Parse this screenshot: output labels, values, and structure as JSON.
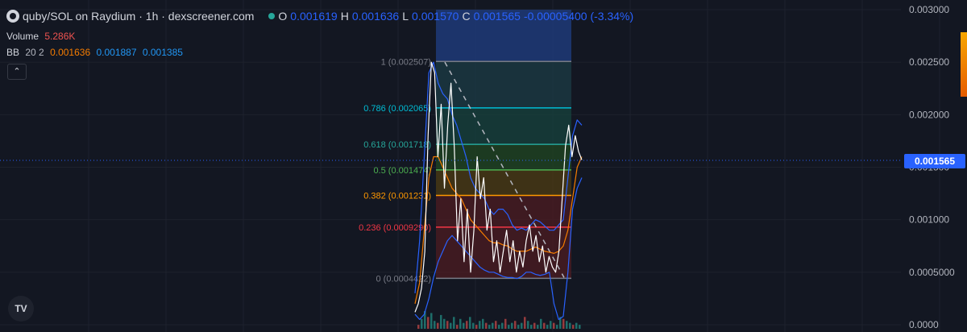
{
  "header": {
    "title": "quby/SOL on Raydium · 1h · dexscreener.com",
    "ohlc": [
      {
        "key": "O",
        "value": "0.001619"
      },
      {
        "key": "H",
        "value": "0.001636"
      },
      {
        "key": "L",
        "value": "0.001570"
      },
      {
        "key": "C",
        "value": "0.001565"
      }
    ],
    "change": "-0.00005400 (-3.34%)"
  },
  "volume": {
    "label": "Volume",
    "value": "5.286K"
  },
  "bb": {
    "label": "BB",
    "params": "20 2",
    "upper": "0.001636",
    "middle": "0.001887",
    "lower": "0.001385",
    "colors": {
      "orange": "#f57c00",
      "blue": "#2196f3"
    }
  },
  "current_price": "0.001565",
  "colors": {
    "background": "#131722",
    "price_line": "#ffffff",
    "bb_band": "#2962ff",
    "accent": "#2962ff"
  },
  "chart_data": {
    "type": "line",
    "y_ticks": [
      "0.003000",
      "0.002500",
      "0.002000",
      "0.001500",
      "0.001000",
      "0.0005000",
      "0.0000"
    ],
    "ylim": [
      0,
      0.003
    ],
    "fib_levels": [
      {
        "label": "1 (0.002507)",
        "value": 0.002507,
        "color": "#787b86",
        "fill": "#363a45"
      },
      {
        "label": "0.786 (0.002065)",
        "value": 0.002065,
        "color": "#00bcd4",
        "fill": "#1c3a44"
      },
      {
        "label": "0.618 (0.001718)",
        "value": 0.001718,
        "color": "#26a69a",
        "fill": "#17403c"
      },
      {
        "label": "0.5 (0.001474)",
        "value": 0.001474,
        "color": "#4caf50",
        "fill": "#1f4422"
      },
      {
        "label": "0.382 (0.001231)",
        "value": 0.001231,
        "color": "#ff9800",
        "fill": "#4a3a14"
      },
      {
        "label": "0.236 (0.0009290)",
        "value": 0.000929,
        "color": "#f23645",
        "fill": "#4a1c22"
      },
      {
        "label": "0 (0.0004422)",
        "value": 0.0004422,
        "color": "#787b86",
        "fill": null
      }
    ],
    "price": [
      0.00012,
      0.0002,
      0.00035,
      0.0007,
      0.0018,
      0.0025,
      0.0024,
      0.0016,
      0.0021,
      0.0013,
      0.0019,
      0.0023,
      0.0017,
      0.0008,
      0.0012,
      0.0006,
      0.0011,
      0.0005,
      0.0009,
      0.0016,
      0.0012,
      0.0014,
      0.0009,
      0.0011,
      0.0006,
      0.0008,
      0.0005,
      0.0007,
      0.0009,
      0.0006,
      0.0008,
      0.0005,
      0.0007,
      0.00055,
      0.0008,
      0.00095,
      0.0007,
      0.00085,
      0.0006,
      0.00075,
      0.0005,
      0.00065,
      0.00055,
      0.0005,
      0.0007,
      0.0012,
      0.0017,
      0.0019,
      0.0016,
      0.0018,
      0.00165,
      0.00157
    ],
    "bb_upper": [
      0.0003,
      0.0008,
      0.0016,
      0.0024,
      0.0025,
      0.0023,
      0.0022,
      0.00215,
      0.002,
      0.0019,
      0.00175,
      0.0016,
      0.0014,
      0.0013,
      0.00125,
      0.0012,
      0.0011,
      0.00105,
      0.0011,
      0.0011,
      0.00105,
      0.00095,
      0.0009,
      0.00092,
      0.0009,
      0.00095,
      0.001,
      0.00098,
      0.00094,
      0.0009,
      0.0009,
      0.00095,
      0.001,
      0.0014,
      0.0018,
      0.00195,
      0.0019
    ],
    "bb_lower": [
      0.0001,
      5e-05,
      0.0001,
      0.00025,
      0.00045,
      0.0006,
      0.0007,
      0.0008,
      0.00085,
      0.0008,
      0.00075,
      0.0007,
      0.00065,
      0.0006,
      0.00055,
      0.00052,
      0.0005,
      0.0005,
      0.00048,
      0.00046,
      0.00045,
      0.00045,
      0.00044,
      0.00046,
      0.0005,
      0.0005,
      0.00048,
      0.00047,
      0.00048,
      0.0005,
      0.0002,
      5e-05,
      8e-05,
      0.0005,
      0.0011,
      0.0013,
      0.0014
    ],
    "bb_basis": [
      0.0002,
      0.0004,
      0.0009,
      0.0014,
      0.0016,
      0.0016,
      0.0015,
      0.0014,
      0.0013,
      0.00125,
      0.0012,
      0.0011,
      0.001,
      0.00095,
      0.0009,
      0.00085,
      0.0008,
      0.00078,
      0.00078,
      0.00076,
      0.00075,
      0.00072,
      0.0007,
      0.0007,
      0.0007,
      0.00072,
      0.00074,
      0.00072,
      0.0007,
      0.00069,
      0.00068,
      0.0007,
      0.00075,
      0.0009,
      0.0012,
      0.0015,
      0.0016
    ],
    "volume": [
      2,
      5,
      9,
      6,
      8,
      4,
      3,
      7,
      5,
      4,
      3,
      6,
      2,
      5,
      3,
      4,
      6,
      3,
      2,
      4,
      5,
      3,
      2,
      3,
      4,
      2,
      3,
      5,
      2,
      3,
      4,
      2,
      3,
      6,
      4,
      2,
      3,
      2,
      5,
      3,
      2,
      4,
      3,
      2,
      6,
      5,
      4,
      3,
      2,
      3,
      2
    ]
  }
}
